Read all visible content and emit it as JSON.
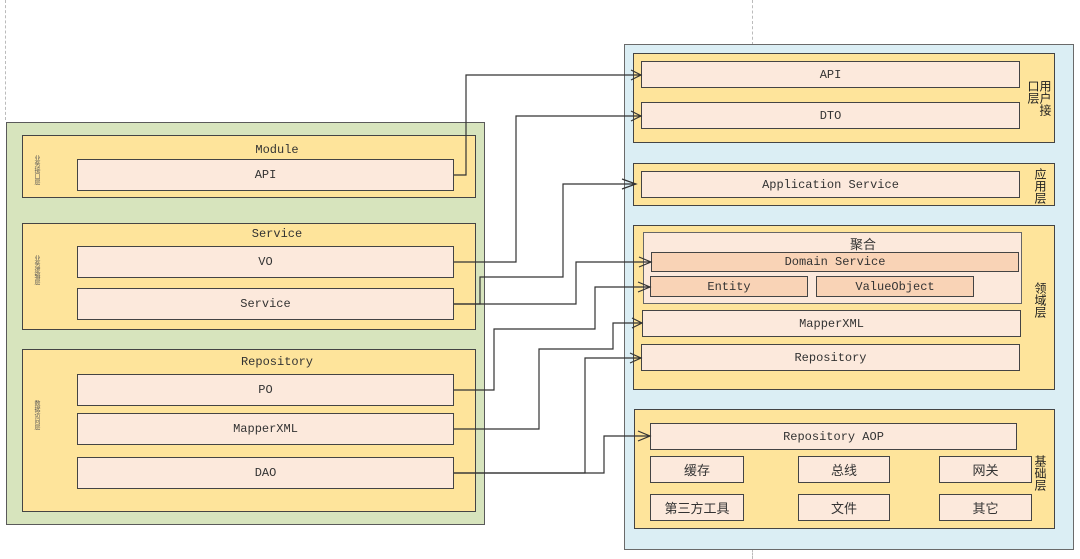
{
  "left_panel": {
    "groups": [
      {
        "title": "Module",
        "side_label": "业务接口层",
        "items": [
          "API"
        ]
      },
      {
        "title": "Service",
        "side_label": "业务逻辑层",
        "items": [
          "VO",
          "Service"
        ]
      },
      {
        "title": "Repository",
        "side_label": "数据访问层",
        "items": [
          "PO",
          "MapperXML",
          "DAO"
        ]
      }
    ]
  },
  "right_panel": {
    "user_interface_layer": {
      "label": "用户接口层",
      "items": [
        "API",
        "DTO"
      ]
    },
    "application_layer": {
      "label": "应用层",
      "items": [
        "Application Service"
      ]
    },
    "domain_layer": {
      "label": "领域层",
      "aggregate": {
        "title": "聚合",
        "domain_service": "Domain Service",
        "entity": "Entity",
        "value_object": "ValueObject"
      },
      "items": [
        "MapperXML",
        "Repository"
      ]
    },
    "infrastructure_layer": {
      "label": "基础层",
      "top_item": "Repository AOP",
      "grid": [
        "缓存",
        "总线",
        "网关",
        "第三方工具",
        "文件",
        "其它"
      ]
    }
  },
  "connections": [
    {
      "from": "Module.API",
      "to": "用户接口层.API"
    },
    {
      "from": "Service.VO",
      "to": "用户接口层.DTO"
    },
    {
      "from": "Service.Service",
      "to": "应用层.Application Service"
    },
    {
      "from": "Service.Service",
      "to": "聚合.Domain Service"
    },
    {
      "from": "Repository.PO",
      "to": "聚合.Entity"
    },
    {
      "from": "Repository.MapperXML",
      "to": "领域层.MapperXML"
    },
    {
      "from": "Repository.DAO",
      "to": "领域层.Repository"
    },
    {
      "from": "Repository.DAO",
      "to": "基础层.Repository AOP"
    }
  ]
}
